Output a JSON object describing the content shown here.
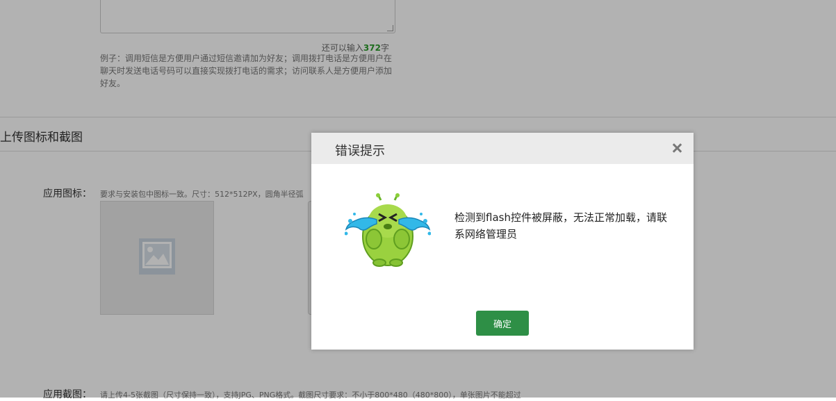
{
  "form": {
    "counter_prefix": "还可以输入",
    "counter_value": "372",
    "counter_suffix": "字",
    "example_hint": "例子：调用短信是方便用户通过短信邀请加为好友；调用拨打电话是方便用户在聊天时发送电话号码可以直接实现拨打电话的需求；访问联系人是方便用户添加好友。"
  },
  "section": {
    "title": "上传图标和截图"
  },
  "app_icon": {
    "label": "应用图标：",
    "requirement": "要求与安装包中图标一致。尺寸：512*512PX，圆角半径弧"
  },
  "screenshots": {
    "label": "应用截图：",
    "requirement": "请上传4-5张截图（尺寸保持一致），支持JPG、PNG格式。截图尺寸要求：不小于800*480（480*800），单张图片不能超过"
  },
  "dialog": {
    "title": "错误提示",
    "message": "检测到flash控件被屏蔽，无法正常加载，请联系网络管理员",
    "confirm_label": "确定",
    "close_icon": "close-icon",
    "illustration": "crying-mascot-icon"
  },
  "colors": {
    "accent_green": "#2e8f46",
    "counter_green": "#2c9c2c",
    "overlay": "rgba(0,0,0,0.30)"
  }
}
